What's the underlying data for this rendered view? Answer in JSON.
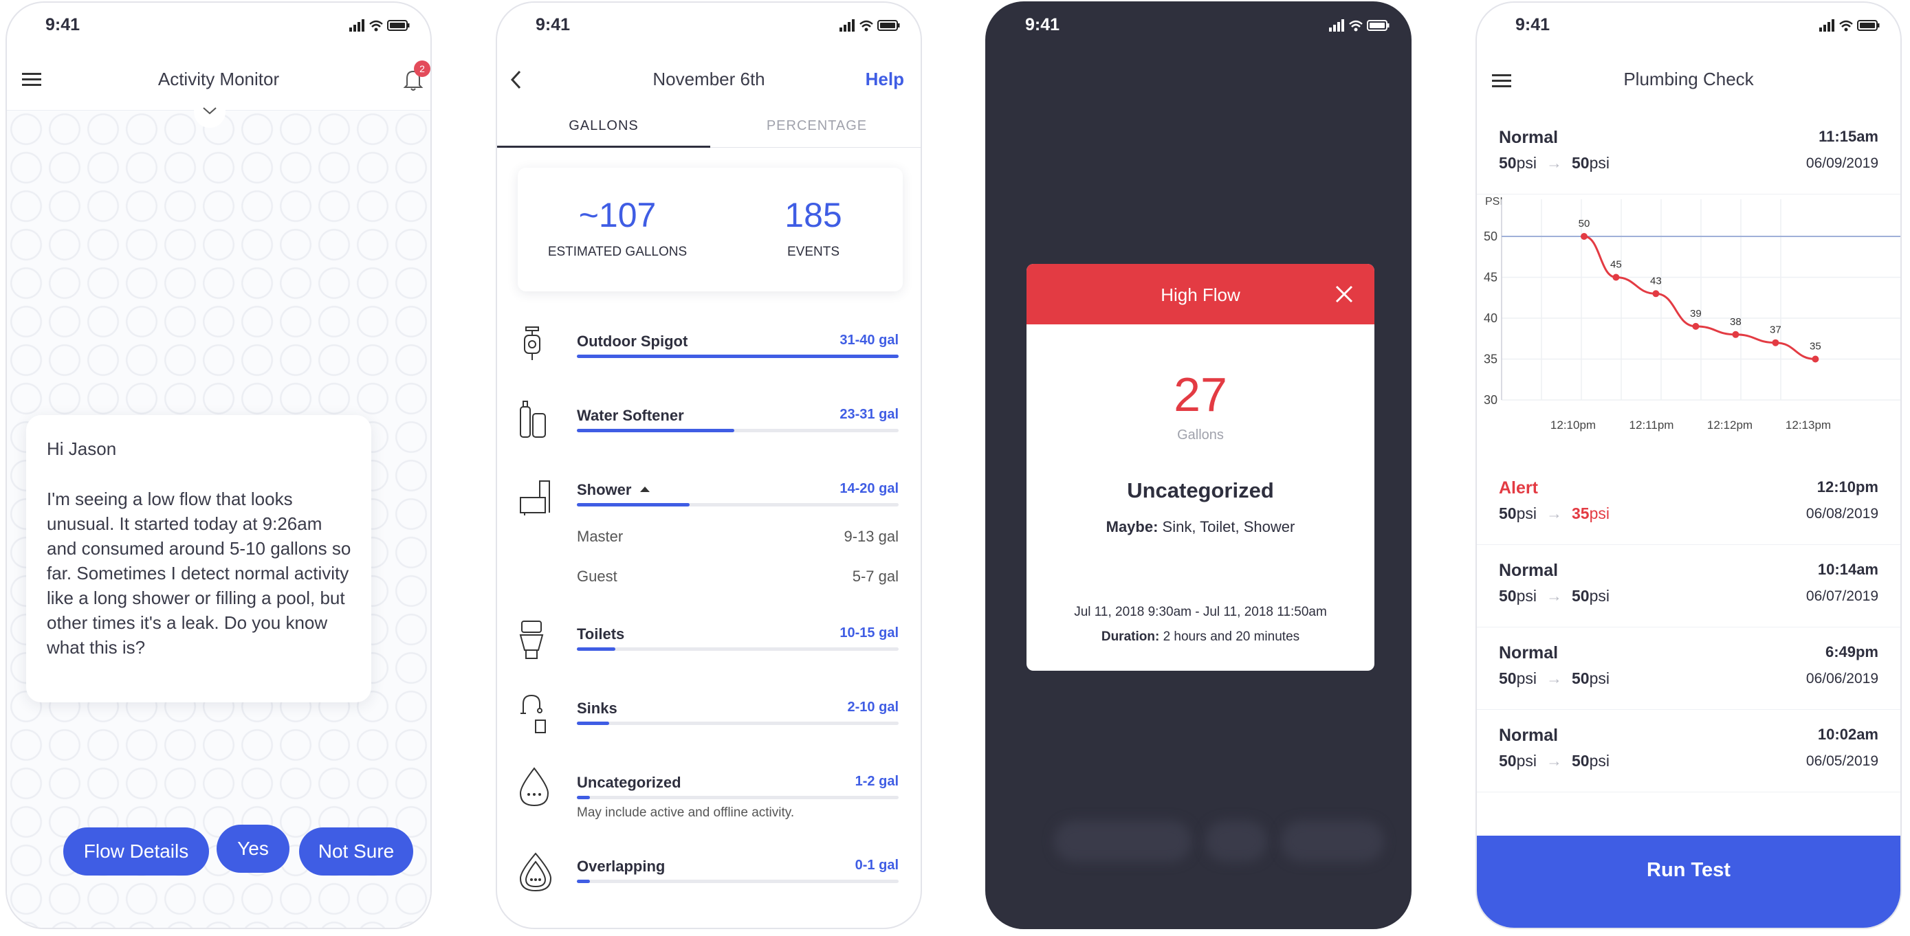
{
  "status_time": "9:41",
  "colors": {
    "accent": "#3f5de4",
    "alert": "#e33b43",
    "dark": "#2f303d"
  },
  "activity": {
    "title": "Activity Monitor",
    "badge": "2",
    "greeting": "Hi Jason",
    "message": "I'm seeing a low flow that looks unusual. It started today at 9:26am and consumed around 5-10 gallons so far. Sometimes I detect normal activity like a long shower or filling a pool, but other times it's a leak. Do you know what this is?",
    "buttons": [
      "Flow Details",
      "Yes",
      "Not Sure"
    ]
  },
  "usage": {
    "title": "November 6th",
    "help": "Help",
    "tabs": [
      "GALLONS",
      "PERCENTAGE"
    ],
    "estimated": "~107",
    "estimated_label": "ESTIMATED GALLONS",
    "events": "185",
    "events_label": "EVENTS",
    "categories": [
      {
        "name": "Outdoor Spigot",
        "range": "31-40 gal",
        "fill": 1.0,
        "icon": "spigot-icon"
      },
      {
        "name": "Water Softener",
        "range": "23-31 gal",
        "fill": 0.49,
        "icon": "water-softener-icon"
      },
      {
        "name": "Shower",
        "range": "14-20 gal",
        "fill": 0.35,
        "icon": "shower-icon",
        "sub": [
          {
            "name": "Master",
            "range": "9-13 gal"
          },
          {
            "name": "Guest",
            "range": "5-7 gal"
          }
        ]
      },
      {
        "name": "Toilets",
        "range": "10-15 gal",
        "fill": 0.12,
        "icon": "toilet-icon"
      },
      {
        "name": "Sinks",
        "range": "2-10 gal",
        "fill": 0.1,
        "icon": "sink-icon"
      },
      {
        "name": "Uncategorized",
        "range": "1-2 gal",
        "fill": 0.04,
        "icon": "droplet-icon",
        "note": "May include active and offline activity."
      },
      {
        "name": "Overlapping",
        "range": "0-1 gal",
        "fill": 0.04,
        "icon": "overlap-droplet-icon"
      }
    ]
  },
  "highflow": {
    "title": "High Flow",
    "amount": "27",
    "unit": "Gallons",
    "category": "Uncategorized",
    "maybe_label": "Maybe:",
    "maybe": "Sink, Toilet, Shower",
    "range": "Jul 11, 2018 9:30am - Jul 11, 2018 11:50am",
    "duration_label": "Duration:",
    "duration": "2 hours and 20 minutes"
  },
  "plumbing": {
    "title": "Plumbing Check",
    "unit": "psi",
    "arrow": "→",
    "tests": [
      {
        "status": "Normal",
        "time": "11:15am",
        "from": "50",
        "to": "50",
        "date": "06/09/2019",
        "alert": false
      },
      {
        "status": "Alert",
        "time": "12:10pm",
        "from": "50",
        "to": "35",
        "date": "06/08/2019",
        "alert": true
      },
      {
        "status": "Normal",
        "time": "10:14am",
        "from": "50",
        "to": "50",
        "date": "06/07/2019",
        "alert": false
      },
      {
        "status": "Normal",
        "time": "6:49pm",
        "from": "50",
        "to": "50",
        "date": "06/06/2019",
        "alert": false
      },
      {
        "status": "Normal",
        "time": "10:02am",
        "from": "50",
        "to": "50",
        "date": "06/05/2019",
        "alert": false
      }
    ],
    "run_button": "Run Test"
  },
  "chart_data": {
    "type": "line",
    "ylabel": "PSI",
    "x_ticks": [
      "12:10pm",
      "12:11pm",
      "12:12pm",
      "12:13pm"
    ],
    "ylim": [
      30,
      50
    ],
    "y_ticks": [
      50,
      45,
      40,
      35,
      30
    ],
    "reference_line": 50,
    "x": [
      0,
      0.4,
      0.9,
      1.4,
      1.9,
      2.4,
      2.9
    ],
    "values": [
      50,
      45,
      43,
      39,
      38,
      37,
      35
    ],
    "grid": true
  }
}
